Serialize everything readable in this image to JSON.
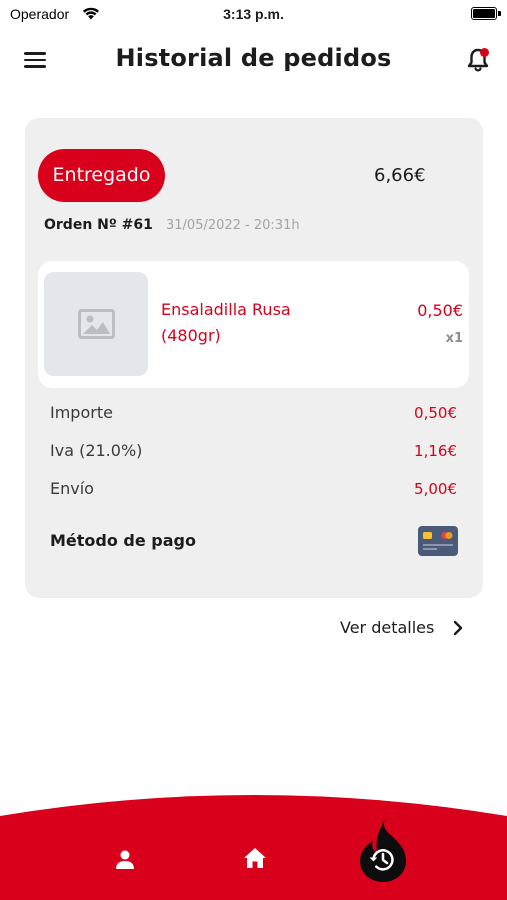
{
  "status_bar": {
    "carrier": "Operador",
    "time": "3:13 p.m."
  },
  "header": {
    "title": "Historial de pedidos",
    "menu_icon": "hamburger-menu-icon",
    "notification_icon": "bell-icon",
    "has_notification": true
  },
  "order": {
    "status": "Entregado",
    "total": "6,66€",
    "number": "Orden Nº #61",
    "date": "31/05/2022 - 20:31h",
    "items": [
      {
        "name": "Ensaladilla Rusa (480gr)",
        "price": "0,50€",
        "quantity": "x1",
        "image_icon": "image-placeholder-icon"
      }
    ],
    "summary": [
      {
        "label": "Importe",
        "value": "0,50€"
      },
      {
        "label": "Iva (21.0%)",
        "value": "1,16€"
      },
      {
        "label": "Envío",
        "value": "5,00€"
      }
    ],
    "payment": {
      "label": "Método de pago",
      "icon": "credit-card-icon"
    }
  },
  "details_link": {
    "label": "Ver detalles",
    "icon": "chevron-right-icon"
  },
  "bottom_nav": {
    "items": [
      {
        "icon": "user-icon",
        "active": false
      },
      {
        "icon": "home-icon",
        "active": false
      },
      {
        "icon": "history-icon",
        "active": true
      }
    ]
  },
  "colors": {
    "accent": "#d9001b",
    "card_background": "#efefef",
    "muted_text": "#a3a3a3"
  }
}
